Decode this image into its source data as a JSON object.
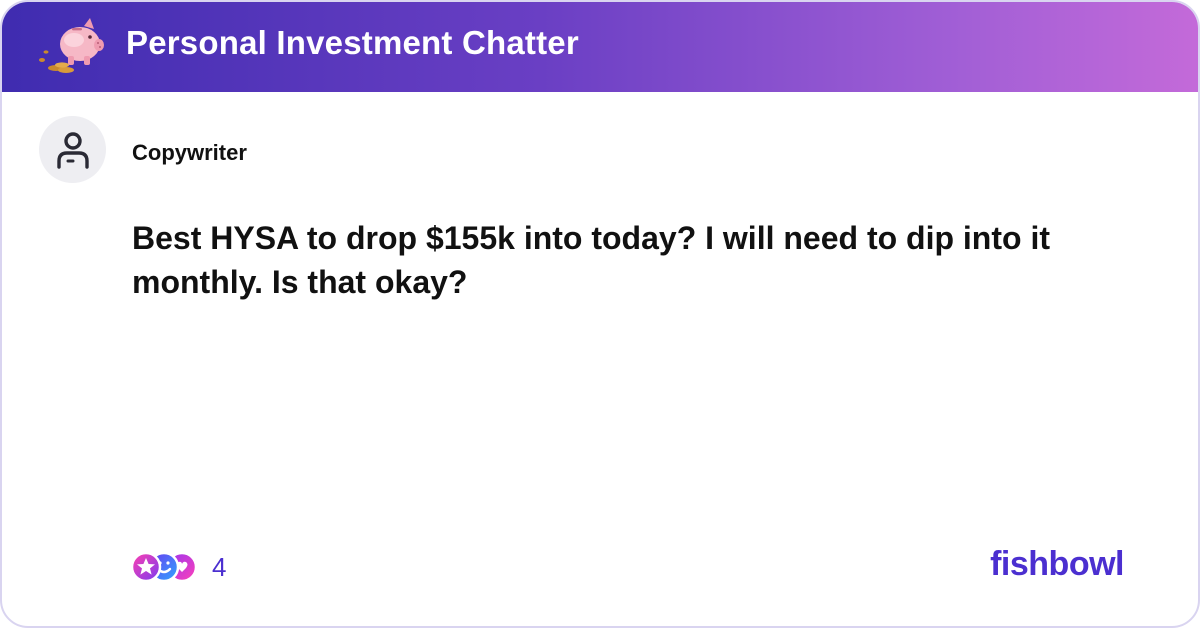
{
  "header": {
    "group_title": "Personal Investment Chatter",
    "group_icon": "piggy-bank-icon"
  },
  "post": {
    "author": "Copywriter",
    "avatar_icon": "person-icon",
    "text": "Best HYSA to drop $155k into today? I will need to dip into it monthly. Is that okay?"
  },
  "footer": {
    "reaction_icons": [
      "star-reaction-icon",
      "smile-reaction-icon",
      "heart-reaction-icon"
    ],
    "reaction_count": "4",
    "brand": "fishbowl"
  },
  "colors": {
    "header_gradient_start": "#3f2cb0",
    "header_gradient_end": "#c46ad9",
    "brand": "#4b2fd0",
    "text": "#111111"
  }
}
